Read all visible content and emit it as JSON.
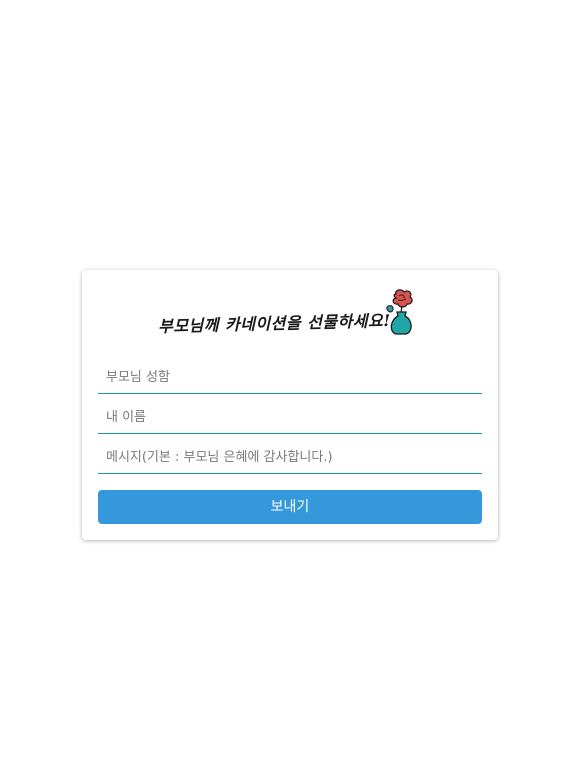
{
  "header": {
    "title": "부모님께 카네이션을 선물하세요!",
    "flower_icon": "carnation-vase-icon"
  },
  "form": {
    "parent_name_placeholder": "부모님 성함",
    "my_name_placeholder": "내 이름",
    "message_placeholder": "메시지(기본 : 부모님 은혜에 감사합니다.)",
    "parent_name_value": "",
    "my_name_value": "",
    "message_value": "",
    "submit_label": "보내기"
  },
  "colors": {
    "accent": "#3498db",
    "input_underline": "#1a9aa0",
    "vase": "#1fa7a7",
    "flower": "#d9534f"
  }
}
